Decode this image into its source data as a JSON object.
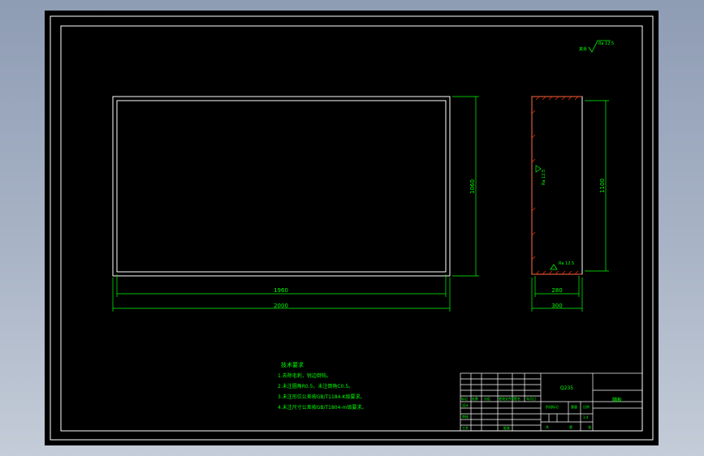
{
  "colors": {
    "background": "#000000",
    "frame": "#ffffff",
    "dimension": "#00ff00",
    "hatch": "#ff3300",
    "surround": "#a9b4c6"
  },
  "front_view": {
    "dim_outer_width": "2000",
    "dim_inner_width": "1960",
    "dim_height": "1060"
  },
  "side_view": {
    "dim_outer_width": "300",
    "dim_inner_width": "280",
    "dim_height": "1100",
    "roughness_mid": "Ra 12.5",
    "roughness_bottom": "Ra 12.5"
  },
  "roughness_general": {
    "prefix": "其余",
    "value": "Ra 12.5"
  },
  "tech_requirements": {
    "title": "技术要求",
    "items": [
      "1.去除毛刺，锐边倒钝。",
      "2.未注圆角R0.5，未注倒角C0.5。",
      "3.未注形位公差按GB/T1184-K级要求。",
      "4.未注尺寸公差按GB/T1804-m级要求。"
    ]
  },
  "title_block": {
    "material": "Q235",
    "part_name": "隔板",
    "labels": [
      "标记",
      "处数",
      "分区",
      "更改文件号",
      "签名",
      "年月日"
    ],
    "rows": [
      "设计",
      "审核",
      "工艺",
      "批准"
    ],
    "stage_label": "阶段标记",
    "weight_label": "重量",
    "scale_label": "比例",
    "scale_value": "1:4",
    "sheet_total": "共",
    "sheet_index": "第",
    "sheet_unit": "张"
  }
}
